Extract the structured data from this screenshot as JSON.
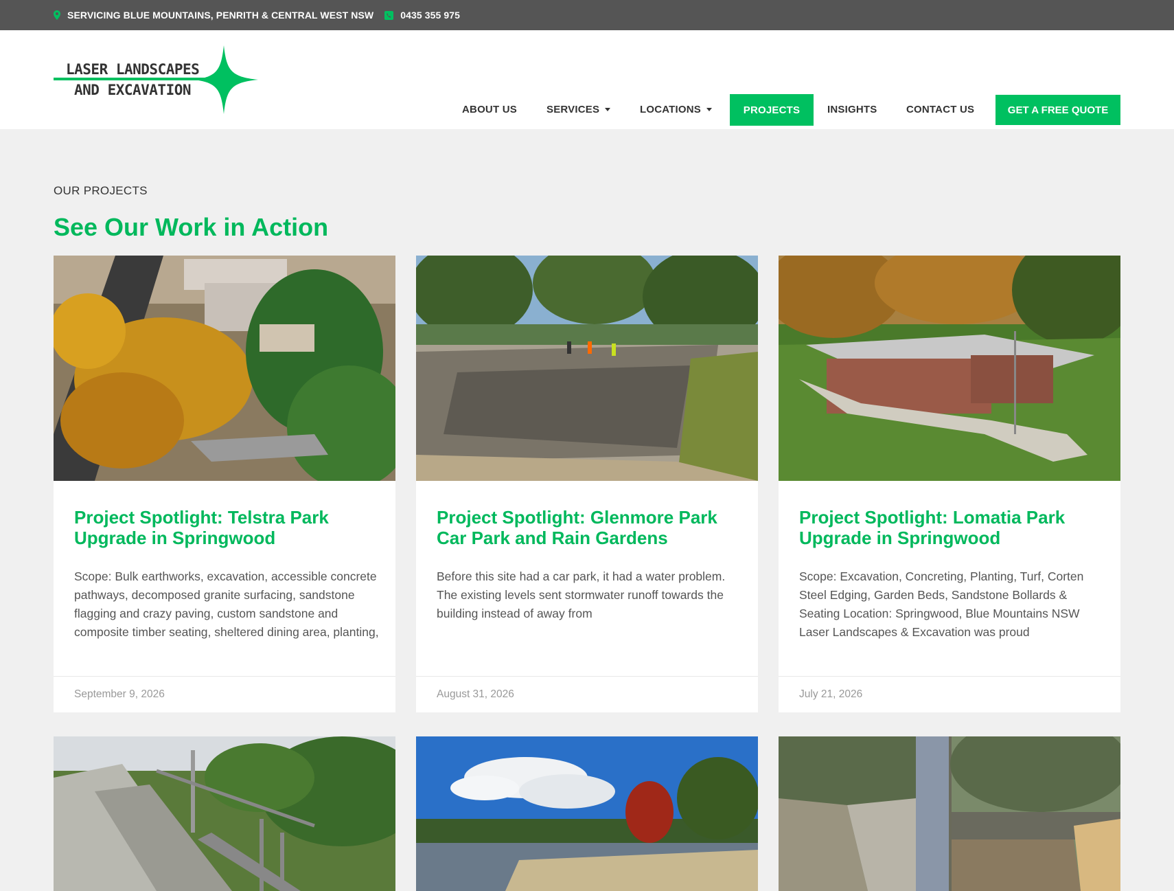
{
  "topbar": {
    "service_area": "SERVICING BLUE MOUNTAINS, PENRITH & CENTRAL WEST NSW",
    "phone": "0435 355 975"
  },
  "logo": {
    "line1": "LASER LANDSCAPES",
    "line2": "AND EXCAVATION"
  },
  "nav": {
    "about": "ABOUT US",
    "services": "SERVICES",
    "locations": "LOCATIONS",
    "projects": "PROJECTS",
    "insights": "INSIGHTS",
    "contact": "CONTACT US",
    "quote": "GET A FREE QUOTE"
  },
  "section": {
    "eyebrow": "OUR PROJECTS",
    "headline": "See Our Work in Action"
  },
  "colors": {
    "brand_green": "#00c060",
    "topbar_bg": "#555555",
    "page_bg": "#f0f0f0"
  },
  "cards": [
    {
      "title": "Project Spotlight: Telstra Park Upgrade in Springwood",
      "excerpt": "Scope: Bulk earthworks, excavation, accessible concrete pathways, decomposed granite surfacing, sandstone flagging and crazy paving, custom sandstone and composite timber seating, sheltered dining area, planting,",
      "date": "September 9, 2026"
    },
    {
      "title": "Project Spotlight: Glenmore Park Car Park and Rain Gardens",
      "excerpt": "Before this site had a car park, it had a water problem. The existing levels sent stormwater runoff towards the building instead of away from",
      "date": "August 31, 2026"
    },
    {
      "title": "Project Spotlight: Lomatia Park Upgrade in Springwood",
      "excerpt": "Scope: Excavation, Concreting, Planting, Turf, Corten Steel Edging, Garden Beds, Sandstone Bollards & Seating Location: Springwood, Blue Mountains NSW Laser Landscapes & Excavation was proud",
      "date": "July 21, 2026"
    }
  ]
}
